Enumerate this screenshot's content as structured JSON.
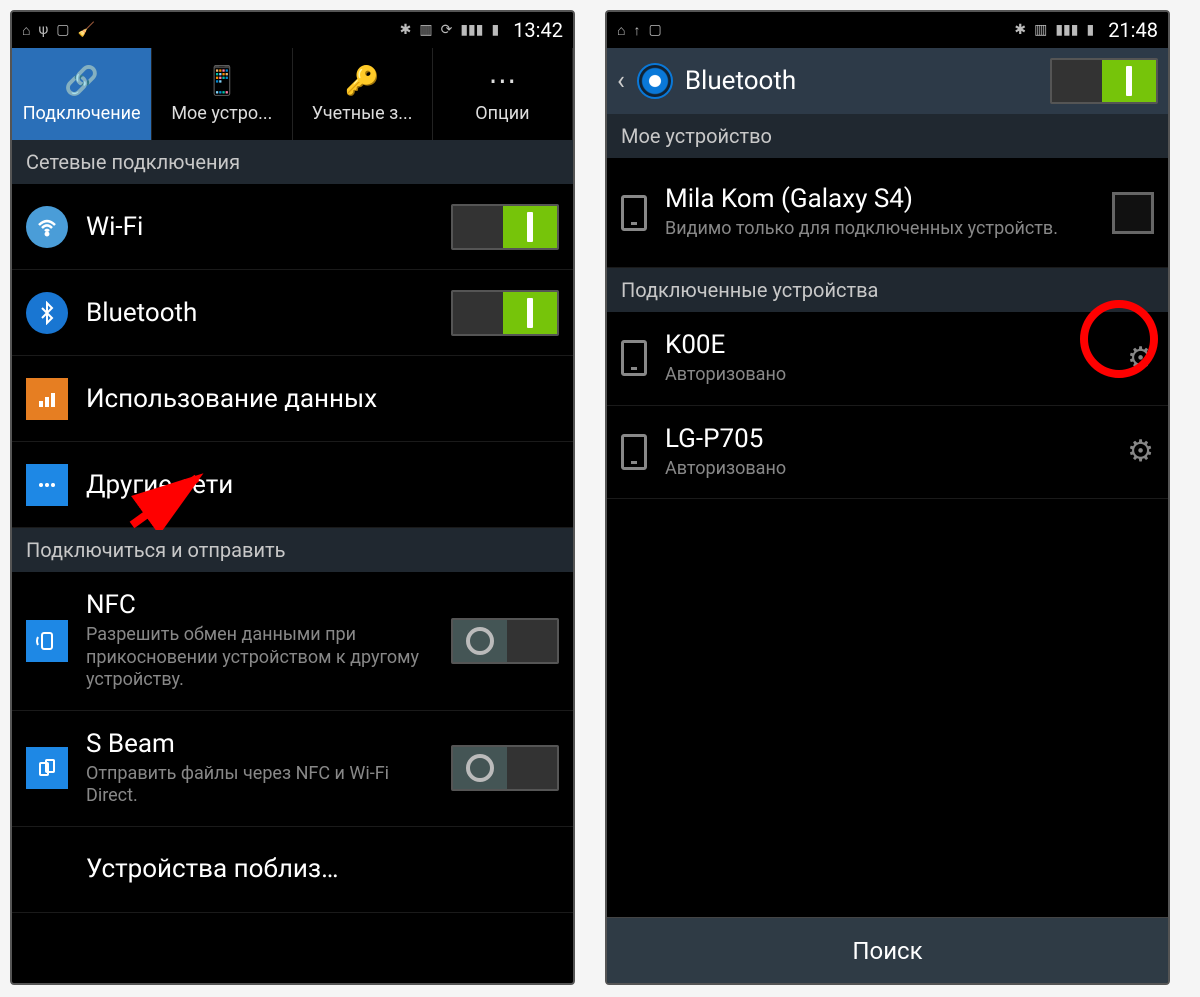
{
  "left": {
    "status": {
      "time": "13:42"
    },
    "tabs": [
      {
        "label": "Подключение"
      },
      {
        "label": "Мое устро..."
      },
      {
        "label": "Учетные з..."
      },
      {
        "label": "Опции"
      }
    ],
    "section1": "Сетевые подключения",
    "wifi": {
      "label": "Wi-Fi"
    },
    "bluetooth": {
      "label": "Bluetooth"
    },
    "data": {
      "label": "Использование данных"
    },
    "more": {
      "label": "Другие сети"
    },
    "section2": "Подключиться и отправить",
    "nfc": {
      "label": "NFC",
      "sub": "Разрешить обмен данными при прикосновении устройством к другому устройству."
    },
    "sbeam": {
      "label": "S Beam",
      "sub": "Отправить файлы через NFC и Wi-Fi Direct."
    },
    "nearby": {
      "label": "Устройства поблиз…"
    }
  },
  "right": {
    "status": {
      "time": "21:48"
    },
    "header": {
      "title": "Bluetooth"
    },
    "section1": "Мое устройство",
    "mydevice": {
      "name": "Mila Kom (Galaxy S4)",
      "sub": "Видимо только для подключенных устройств."
    },
    "section2": "Подключенные устройства",
    "dev1": {
      "name": "K00E",
      "sub": "Авторизовано"
    },
    "dev2": {
      "name": "LG-P705",
      "sub": "Авторизовано"
    },
    "footer": "Поиск"
  }
}
